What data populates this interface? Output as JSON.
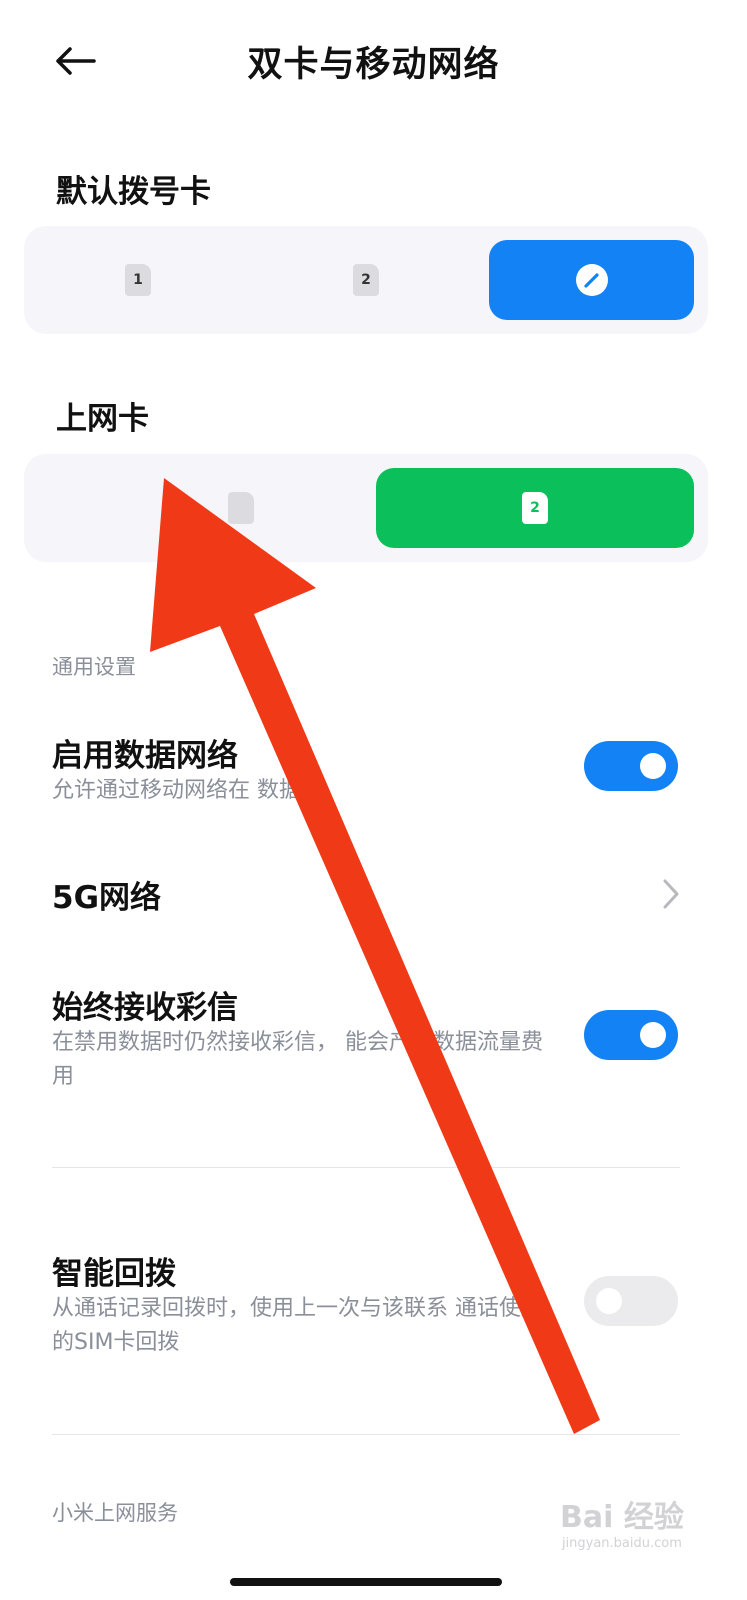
{
  "header": {
    "title": "双卡与移动网络",
    "back_icon": "arrow-left-icon"
  },
  "default_dial": {
    "label": "默认拨号卡",
    "options": [
      {
        "chip": "1",
        "selected": false
      },
      {
        "chip": "2",
        "selected": false
      },
      {
        "icon": "edit-pencil-icon",
        "selected": true
      }
    ]
  },
  "data_card": {
    "label": "上网卡",
    "options": [
      {
        "chip": "",
        "selected": false
      },
      {
        "chip": "2",
        "selected": true
      }
    ]
  },
  "general": {
    "title": "通用设置",
    "enable_data": {
      "title": "启用数据网络",
      "subtitle": "允许通过移动网络在      数据",
      "on": true
    },
    "five_g": {
      "title": "5G网络"
    },
    "mms": {
      "title": "始终接收彩信",
      "subtitle": "在禁用数据时仍然接收彩信，      能会产生数据流量费用",
      "on": true
    },
    "smart_callback": {
      "title": "智能回拨",
      "subtitle": "从通话记录回拨时，使用上一次与该联系      通话使用的SIM卡回拨",
      "on": false
    }
  },
  "xiaomi": {
    "title": "小米上网服务"
  },
  "watermark": {
    "text": "Bai 经验",
    "url": "jingyan.baidu.com"
  },
  "colors": {
    "accent_blue": "#1282f5",
    "selected_green": "#0bbf5a",
    "arrow_red": "#f03a17"
  }
}
